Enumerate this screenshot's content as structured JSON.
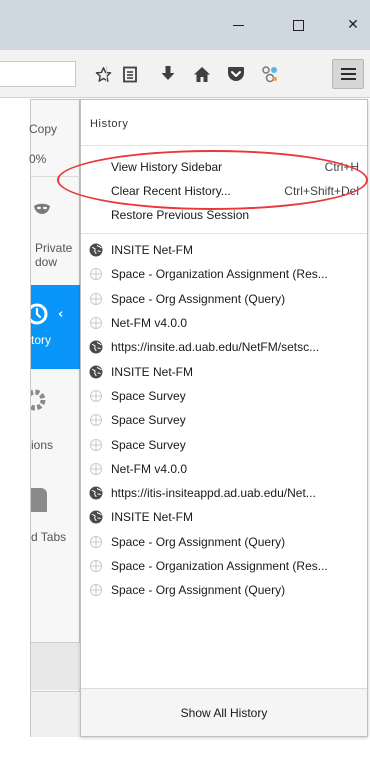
{
  "window": {
    "controls": [
      {
        "name": "minimize",
        "icon": "minimize-icon"
      },
      {
        "name": "maximize",
        "icon": "maximize-icon"
      },
      {
        "name": "close",
        "icon": "close-icon",
        "glyph": "✕"
      }
    ]
  },
  "toolbar": {
    "icons": [
      "star-icon",
      "reader-list-icon",
      "download-icon",
      "home-icon",
      "pocket-icon",
      "extension-icon",
      "hamburger-menu-icon"
    ]
  },
  "main_panel": {
    "copy_label": "Copy",
    "zoom_label": "0%",
    "private_label_line1": "Private",
    "private_label_line2": "dow",
    "history_label": "tory",
    "options_label": "ions",
    "tabs_label": "d Tabs"
  },
  "history_panel": {
    "header": "History",
    "actions": [
      {
        "label": "View History Sidebar",
        "shortcut": "Ctrl+H"
      },
      {
        "label": "Clear Recent History...",
        "shortcut": "Ctrl+Shift+Del"
      },
      {
        "label": "Restore Previous Session",
        "shortcut": ""
      }
    ],
    "items": [
      {
        "title": "INSITE Net-FM",
        "icon": "globe"
      },
      {
        "title": "Space - Organization Assignment (Res...",
        "icon": "page"
      },
      {
        "title": "Space - Org Assignment (Query)",
        "icon": "page"
      },
      {
        "title": "Net-FM v4.0.0",
        "icon": "page"
      },
      {
        "title": "https://insite.ad.uab.edu/NetFM/setsc...",
        "icon": "globe"
      },
      {
        "title": "INSITE Net-FM",
        "icon": "globe"
      },
      {
        "title": "Space Survey",
        "icon": "page"
      },
      {
        "title": "Space Survey",
        "icon": "page"
      },
      {
        "title": "Space Survey",
        "icon": "page"
      },
      {
        "title": "Net-FM v4.0.0",
        "icon": "page"
      },
      {
        "title": "https://itis-insiteappd.ad.uab.edu/Net...",
        "icon": "globe"
      },
      {
        "title": "INSITE Net-FM",
        "icon": "globe"
      },
      {
        "title": "Space - Org Assignment (Query)",
        "icon": "page"
      },
      {
        "title": "Space - Organization Assignment (Res...",
        "icon": "page"
      },
      {
        "title": "Space - Org Assignment (Query)",
        "icon": "page"
      }
    ],
    "footer": "Show All History"
  },
  "colors": {
    "titlebar": "#cfd7e1",
    "accent": "#0996f8",
    "highlight": "#e8383d"
  }
}
